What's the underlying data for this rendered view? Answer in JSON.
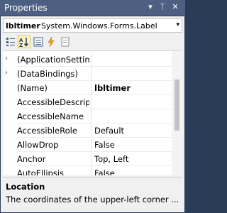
{
  "window": {
    "title": "Properties",
    "dropdown_icon": "▾",
    "pin_icon": "ᛉ",
    "close_icon": "✕"
  },
  "object_selector": {
    "name": "lbltimer",
    "type": "System.Windows.Forms.Label",
    "arrow": "▾"
  },
  "toolbar": {
    "buttons": [
      "categorized-icon",
      "alphabetical-icon",
      "properties-icon",
      "events-icon",
      "property-pages-icon"
    ]
  },
  "properties": [
    {
      "expand": "›",
      "name": "(ApplicationSettings)",
      "value": ""
    },
    {
      "expand": "›",
      "name": "(DataBindings)",
      "value": ""
    },
    {
      "expand": "",
      "name": "(Name)",
      "value": "lbltimer"
    },
    {
      "expand": "",
      "name": "AccessibleDescription",
      "value": ""
    },
    {
      "expand": "",
      "name": "AccessibleName",
      "value": ""
    },
    {
      "expand": "",
      "name": "AccessibleRole",
      "value": "Default"
    },
    {
      "expand": "",
      "name": "AllowDrop",
      "value": "False"
    },
    {
      "expand": "",
      "name": "Anchor",
      "value": "Top, Left"
    },
    {
      "expand": "",
      "name": "AutoEllipsis",
      "value": "False"
    }
  ],
  "description": {
    "title": "Location",
    "text": "The coordinates of the upper-left corner ..."
  },
  "colors": {
    "title_bar": "#4D6082",
    "frame": "#2B3C59",
    "active_button": "#FDF4BF"
  }
}
